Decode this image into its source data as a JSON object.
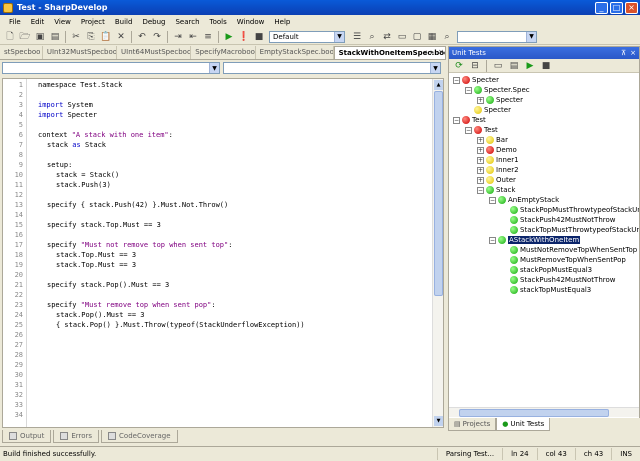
{
  "window": {
    "title": "Test - SharpDevelop"
  },
  "menu": [
    "File",
    "Edit",
    "View",
    "Project",
    "Build",
    "Debug",
    "Search",
    "Tools",
    "Window",
    "Help"
  ],
  "toolbar": {
    "config_value": "Default"
  },
  "doc_tabs": [
    {
      "label": "stSpecboo",
      "active": false
    },
    {
      "label": "UInt32MustSpecboo",
      "active": false
    },
    {
      "label": "UInt64MustSpecboo",
      "active": false
    },
    {
      "label": "SpecifyMacroboo",
      "active": false
    },
    {
      "label": "EmptyStackSpec.boo",
      "active": false
    },
    {
      "label": "StackWithOneItemSpec.boo",
      "active": true
    }
  ],
  "tab_controls": {
    "left": "◂",
    "right": "▸",
    "close": "×"
  },
  "code_lines": [
    {
      "n": "1",
      "indent": 1,
      "parts": [
        {
          "t": "namespace Test.Stack",
          "c": ""
        }
      ]
    },
    {
      "n": "2",
      "indent": 0,
      "parts": []
    },
    {
      "n": "3",
      "indent": 1,
      "parts": [
        {
          "t": "import",
          "c": "kw"
        },
        {
          "t": " System",
          "c": ""
        }
      ]
    },
    {
      "n": "4",
      "indent": 1,
      "parts": [
        {
          "t": "import",
          "c": "kw"
        },
        {
          "t": " Specter",
          "c": ""
        }
      ]
    },
    {
      "n": "5",
      "indent": 0,
      "parts": []
    },
    {
      "n": "6",
      "indent": 1,
      "parts": [
        {
          "t": "context ",
          "c": ""
        },
        {
          "t": "\"A stack with one item\"",
          "c": "str"
        },
        {
          "t": ":",
          "c": ""
        }
      ]
    },
    {
      "n": "7",
      "indent": 2,
      "parts": [
        {
          "t": "stack ",
          "c": ""
        },
        {
          "t": "as",
          "c": "kw"
        },
        {
          "t": " Stack",
          "c": ""
        }
      ]
    },
    {
      "n": "8",
      "indent": 0,
      "parts": []
    },
    {
      "n": "9",
      "indent": 2,
      "parts": [
        {
          "t": "setup:",
          "c": ""
        }
      ]
    },
    {
      "n": "10",
      "indent": 3,
      "parts": [
        {
          "t": "stack = Stack()",
          "c": ""
        }
      ]
    },
    {
      "n": "11",
      "indent": 3,
      "parts": [
        {
          "t": "stack.Push(3)",
          "c": ""
        }
      ]
    },
    {
      "n": "12",
      "indent": 0,
      "parts": []
    },
    {
      "n": "13",
      "indent": 2,
      "parts": [
        {
          "t": "specify { stack.Push(42) }.Must.Not.Throw()",
          "c": ""
        }
      ]
    },
    {
      "n": "14",
      "indent": 0,
      "parts": []
    },
    {
      "n": "15",
      "indent": 2,
      "parts": [
        {
          "t": "specify stack.Top.Must == 3",
          "c": ""
        }
      ]
    },
    {
      "n": "16",
      "indent": 0,
      "parts": []
    },
    {
      "n": "17",
      "indent": 2,
      "parts": [
        {
          "t": "specify ",
          "c": ""
        },
        {
          "t": "\"Must not remove top when sent top\"",
          "c": "str"
        },
        {
          "t": ":",
          "c": ""
        }
      ]
    },
    {
      "n": "18",
      "indent": 3,
      "parts": [
        {
          "t": "stack.Top.Must == 3",
          "c": ""
        }
      ]
    },
    {
      "n": "19",
      "indent": 3,
      "parts": [
        {
          "t": "stack.Top.Must == 3",
          "c": ""
        }
      ]
    },
    {
      "n": "20",
      "indent": 0,
      "parts": []
    },
    {
      "n": "21",
      "indent": 2,
      "parts": [
        {
          "t": "specify stack.Pop().Must == 3",
          "c": ""
        }
      ]
    },
    {
      "n": "22",
      "indent": 0,
      "parts": []
    },
    {
      "n": "23",
      "indent": 2,
      "parts": [
        {
          "t": "specify ",
          "c": ""
        },
        {
          "t": "\"Must remove top when sent pop\"",
          "c": "str"
        },
        {
          "t": ":",
          "c": ""
        }
      ]
    },
    {
      "n": "24",
      "indent": 3,
      "parts": [
        {
          "t": "stack.Pop().Must == 3",
          "c": ""
        }
      ]
    },
    {
      "n": "25",
      "indent": 3,
      "parts": [
        {
          "t": "{ stack.Pop() }.Must.Throw(typeof(StackUnderflowException))",
          "c": ""
        }
      ]
    },
    {
      "n": "26",
      "indent": 0,
      "parts": []
    },
    {
      "n": "27",
      "indent": 0,
      "parts": []
    },
    {
      "n": "28",
      "indent": 0,
      "parts": []
    },
    {
      "n": "29",
      "indent": 0,
      "parts": []
    },
    {
      "n": "30",
      "indent": 0,
      "parts": []
    },
    {
      "n": "31",
      "indent": 0,
      "parts": []
    },
    {
      "n": "32",
      "indent": 0,
      "parts": []
    },
    {
      "n": "33",
      "indent": 0,
      "parts": []
    },
    {
      "n": "34",
      "indent": 0,
      "parts": []
    }
  ],
  "bottom_tabs": [
    "Output",
    "Errors",
    "CodeCoverage"
  ],
  "status": {
    "message": "Build finished successfully.",
    "progress": "Parsing Test...",
    "line": "ln 24",
    "col": "col 43",
    "ch": "ch 43",
    "mode": "INS"
  },
  "unit_tests": {
    "title": "Unit Tests",
    "header_controls": {
      "pin": "⊼",
      "close": "×"
    },
    "tree": [
      {
        "label": "Specter",
        "level": 0,
        "status": "red",
        "expander": "−"
      },
      {
        "label": "Specter.Spec",
        "level": 1,
        "status": "green",
        "expander": "−"
      },
      {
        "label": "Specter",
        "level": 2,
        "status": "green",
        "expander": "+"
      },
      {
        "label": "Specter",
        "level": 1,
        "status": "yellow",
        "expander": ""
      },
      {
        "label": "Test",
        "level": 0,
        "status": "red",
        "expander": "−"
      },
      {
        "label": "Test",
        "level": 1,
        "status": "red",
        "expander": "−"
      },
      {
        "label": "Bar",
        "level": 2,
        "status": "yellow",
        "expander": "+"
      },
      {
        "label": "Demo",
        "level": 2,
        "status": "red",
        "expander": "+"
      },
      {
        "label": "Inner1",
        "level": 2,
        "status": "yellow",
        "expander": "+"
      },
      {
        "label": "Inner2",
        "level": 2,
        "status": "yellow",
        "expander": "+"
      },
      {
        "label": "Outer",
        "level": 2,
        "status": "yellow",
        "expander": "+"
      },
      {
        "label": "Stack",
        "level": 2,
        "status": "green",
        "expander": "−"
      },
      {
        "label": "AnEmptyStack",
        "level": 3,
        "status": "green",
        "expander": "−"
      },
      {
        "label": "StackPopMustThrowtypeofStackUn",
        "level": 4,
        "status": "green",
        "expander": ""
      },
      {
        "label": "StackPush42MustNotThrow",
        "level": 4,
        "status": "green",
        "expander": ""
      },
      {
        "label": "StackTopMustThrowtypeofStackUn",
        "level": 4,
        "status": "green",
        "expander": ""
      },
      {
        "label": "AStackWithOneItem",
        "level": 3,
        "status": "green",
        "expander": "−",
        "selected": true
      },
      {
        "label": "MustNotRemoveTopWhenSentTop",
        "level": 4,
        "status": "green",
        "expander": ""
      },
      {
        "label": "MustRemoveTopWhenSentPop",
        "level": 4,
        "status": "green",
        "expander": ""
      },
      {
        "label": "stackPopMustEqual3",
        "level": 4,
        "status": "green",
        "expander": ""
      },
      {
        "label": "StackPush42MustNotThrow",
        "level": 4,
        "status": "green",
        "expander": ""
      },
      {
        "label": "stackTopMustEqual3",
        "level": 4,
        "status": "green",
        "expander": ""
      }
    ],
    "tabs": [
      {
        "label": "Projects",
        "active": false
      },
      {
        "label": "Unit Tests",
        "active": true
      }
    ]
  },
  "colors": {
    "titlebar": "#0b4fc8",
    "keyword": "#0000c8",
    "string": "#800080",
    "fail": "#cc0000",
    "pass": "#14a80e",
    "ignored": "#e2c400"
  }
}
